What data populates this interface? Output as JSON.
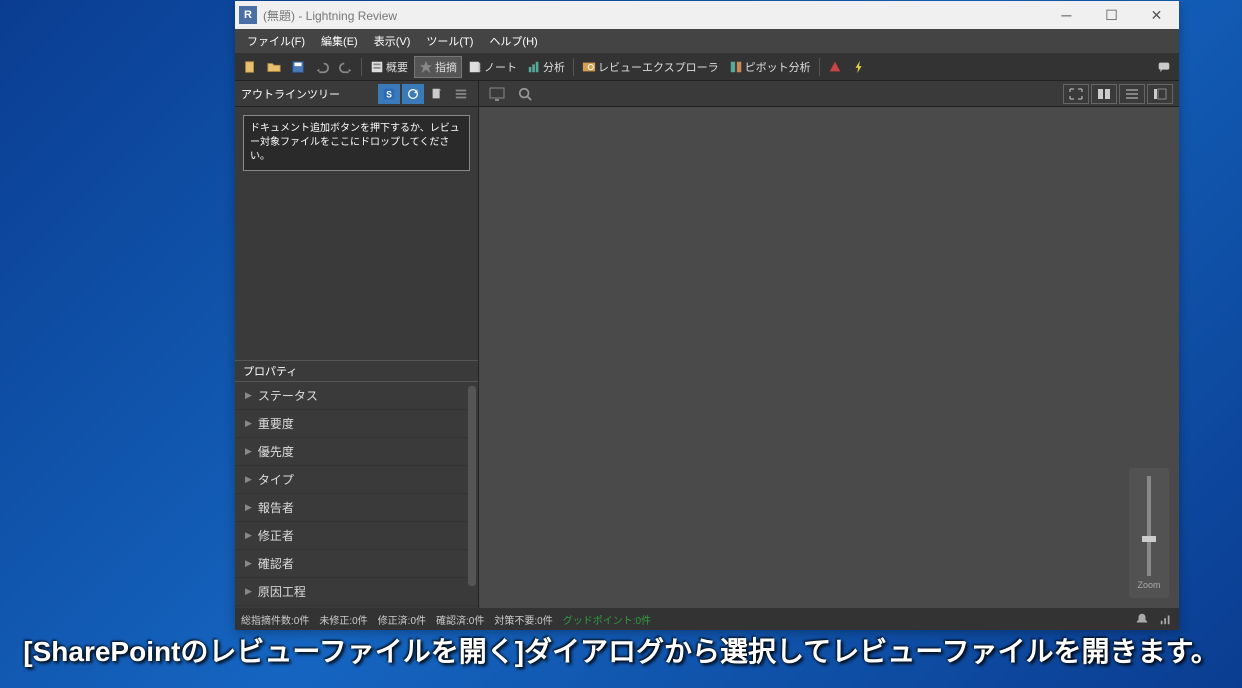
{
  "window": {
    "untitled": "(無題)",
    "app_name": " - Lightning Review",
    "icon_letter": "R"
  },
  "menu": {
    "file": "ファイル(F)",
    "edit": "編集(E)",
    "view": "表示(V)",
    "tool": "ツール(T)",
    "help": "ヘルプ(H)"
  },
  "toolbar": {
    "overview": "概要",
    "issue": "指摘",
    "note": "ノート",
    "analysis": "分析",
    "review_explorer": "レビューエクスプローラ",
    "pivot": "ピボット分析"
  },
  "sidebar": {
    "outline_tree": "アウトラインツリー",
    "drop_hint": "ドキュメント追加ボタンを押下するか、レビュー対象ファイルをここにドロップしてください。",
    "properties": "プロパティ",
    "prop_items": [
      "ステータス",
      "重要度",
      "優先度",
      "タイプ",
      "報告者",
      "修正者",
      "確認者",
      "原因工程"
    ]
  },
  "zoom": {
    "label": "Zoom"
  },
  "status": {
    "total": "総指摘件数:0件",
    "unfixed": "未修正:0件",
    "fixed": "修正済:0件",
    "confirmed": "確認済:0件",
    "noaction": "対策不要:0件",
    "goodpoint": "グッドポイント:0件"
  },
  "caption": "[SharePointのレビューファイルを開く]ダイアログから選択してレビューファイルを開きます。"
}
